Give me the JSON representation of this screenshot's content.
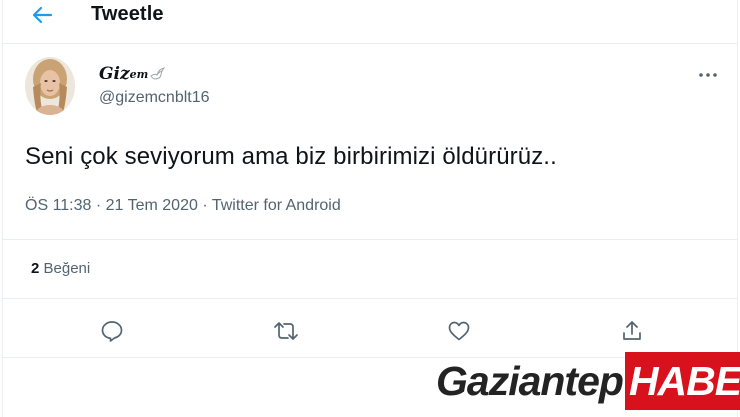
{
  "header": {
    "title": "Tweetle",
    "back_icon": "back-arrow-icon"
  },
  "user": {
    "display_name_part1": "Giz",
    "display_name_part2": "em",
    "handle": "@gizemcnblt16",
    "avatar": "avatar-photo"
  },
  "tweet": {
    "text": "Seni çok seviyorum ama biz birbirimizi öldürürüz..",
    "time": "ÖS 11:38",
    "separator": "·",
    "date": "21 Tem 2020",
    "source": "Twitter for Android"
  },
  "stats": {
    "likes_count": "2",
    "likes_label": "Beğeni"
  },
  "actions": {
    "reply": "reply-icon",
    "retweet": "retweet-icon",
    "like": "heart-icon",
    "share": "share-icon",
    "more": "more-icon"
  },
  "watermark": {
    "part1": "Gaziantep",
    "part2": "HABER"
  },
  "colors": {
    "accent": "#1d9bf0",
    "text_primary": "#0f1419",
    "text_secondary": "#536471",
    "divider": "#ebeef0",
    "watermark_red": "#d8121d"
  }
}
